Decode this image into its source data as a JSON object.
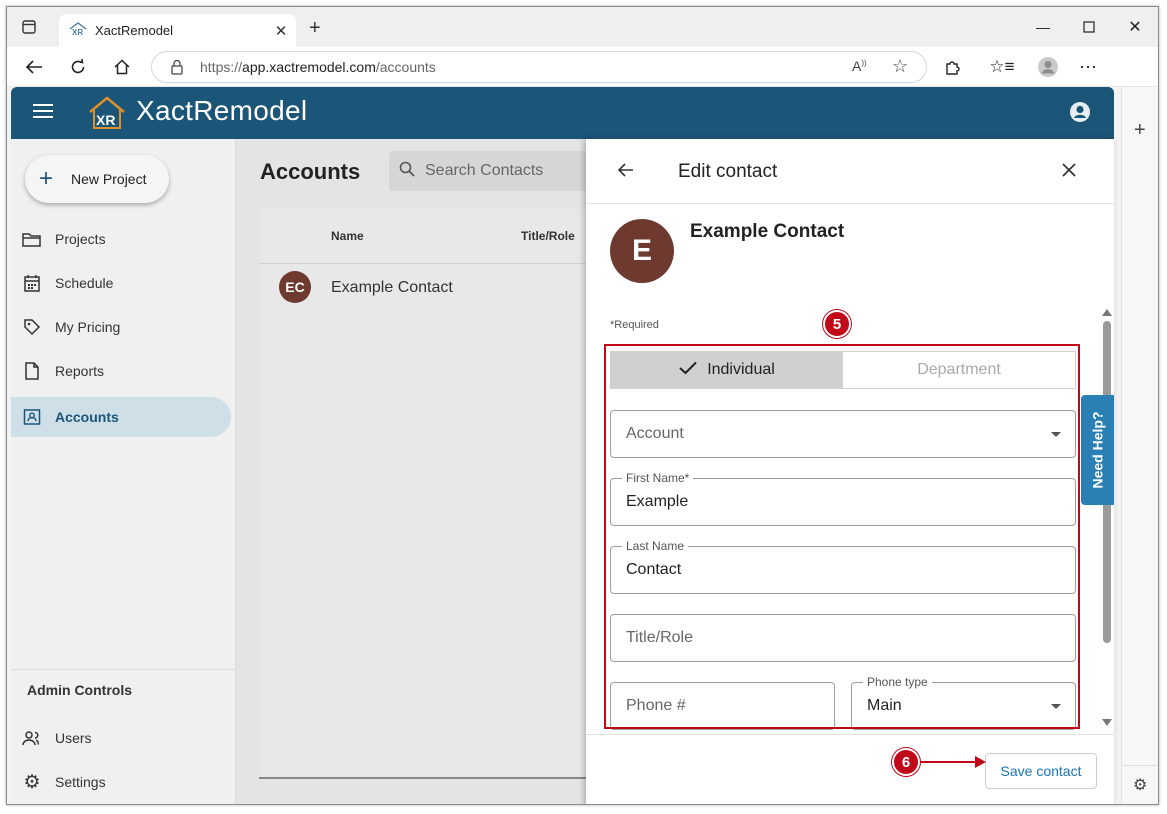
{
  "browser": {
    "tab_title": "XactRemodel",
    "url_proto": "https://",
    "url_host": "app.xactremodel.com",
    "url_path": "/accounts"
  },
  "app": {
    "brand": "XactRemodel",
    "brand_logo": "XR",
    "accent": "#1b5578"
  },
  "sidebar": {
    "new_project": "New Project",
    "items": [
      {
        "label": "Projects",
        "icon": "folder-icon"
      },
      {
        "label": "Schedule",
        "icon": "calendar-icon"
      },
      {
        "label": "My Pricing",
        "icon": "tag-icon"
      },
      {
        "label": "Reports",
        "icon": "document-icon"
      },
      {
        "label": "Accounts",
        "icon": "contact-card-icon"
      }
    ],
    "admin_title": "Admin Controls",
    "admin_items": [
      {
        "label": "Users",
        "icon": "users-icon"
      },
      {
        "label": "Settings",
        "icon": "gear-icon"
      }
    ]
  },
  "main": {
    "title": "Accounts",
    "search_placeholder": "Search Contacts",
    "columns": [
      "Name",
      "Title/Role"
    ],
    "rows": [
      {
        "initials": "EC",
        "name": "Example Contact"
      }
    ]
  },
  "drawer": {
    "title": "Edit contact",
    "avatar_initial": "E",
    "contact_name": "Example Contact",
    "required_note": "*Required",
    "toggle": {
      "individual": "Individual",
      "department": "Department"
    },
    "account_placeholder": "Account",
    "first_name_label": "First Name*",
    "first_name_value": "Example",
    "last_name_label": "Last Name",
    "last_name_value": "Contact",
    "title_placeholder": "Title/Role",
    "phone_placeholder": "Phone #",
    "phone_type_label": "Phone type",
    "phone_type_value": "Main",
    "need_help": "Need Help?",
    "save_label": "Save contact"
  },
  "annotations": {
    "step5": "5",
    "step6": "6"
  }
}
